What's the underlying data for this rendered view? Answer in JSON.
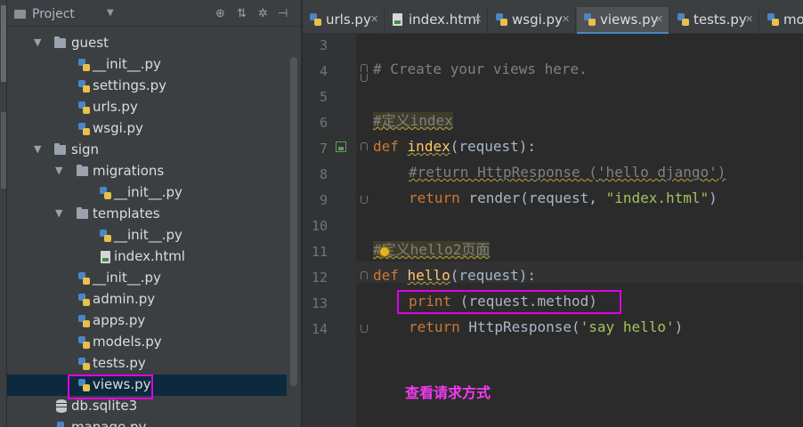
{
  "project_panel": {
    "title": "Project",
    "tree": [
      {
        "label": "guest",
        "kind": "folder"
      },
      {
        "label": "__init__.py",
        "kind": "py"
      },
      {
        "label": "settings.py",
        "kind": "py"
      },
      {
        "label": "urls.py",
        "kind": "py"
      },
      {
        "label": "wsgi.py",
        "kind": "py"
      },
      {
        "label": "sign",
        "kind": "folder"
      },
      {
        "label": "migrations",
        "kind": "folder"
      },
      {
        "label": "__init__.py",
        "kind": "py"
      },
      {
        "label": "templates",
        "kind": "folder"
      },
      {
        "label": "__init__.py",
        "kind": "py"
      },
      {
        "label": "index.html",
        "kind": "html"
      },
      {
        "label": "__init__.py",
        "kind": "py"
      },
      {
        "label": "admin.py",
        "kind": "py"
      },
      {
        "label": "apps.py",
        "kind": "py"
      },
      {
        "label": "models.py",
        "kind": "py"
      },
      {
        "label": "tests.py",
        "kind": "py"
      },
      {
        "label": "views.py",
        "kind": "py",
        "selected": true
      },
      {
        "label": "db.sqlite3",
        "kind": "db"
      },
      {
        "label": "manage.py",
        "kind": "py"
      }
    ]
  },
  "tabs": [
    {
      "label": "urls.py",
      "icon": "python-file-icon"
    },
    {
      "label": "index.html",
      "icon": "html-file-icon"
    },
    {
      "label": "wsgi.py",
      "icon": "python-file-icon"
    },
    {
      "label": "views.py",
      "icon": "python-file-icon",
      "active": true
    },
    {
      "label": "tests.py",
      "icon": "python-file-icon"
    },
    {
      "label": "mo",
      "icon": "python-file-icon"
    }
  ],
  "editor": {
    "line_numbers": [
      "3",
      "4",
      "5",
      "6",
      "7",
      "8",
      "9",
      "10",
      "11",
      "12",
      "13",
      "14"
    ],
    "code": {
      "l4": "# Create your views here.",
      "l6": "#定义index",
      "l7_kw": "def",
      "l7_fn": "index",
      "l7_rest": "(request):",
      "l8": "#return HttpResponse ('hello django')",
      "l9_kw": "return",
      "l9_mid": " render(request, ",
      "l9_str": "\"index.html\"",
      "l9_end": ")",
      "l11": "#定义hello2页面",
      "l12_kw": "def",
      "l12_fn": "hello",
      "l12_rest": "(request):",
      "l13_kw": "print",
      "l13_rest": " (request.method)",
      "l14_kw": "return",
      "l14_mid": " HttpResponse(",
      "l14_str": "'say hello'",
      "l14_end": ")"
    }
  },
  "annotation": "查看请求方式",
  "colors": {
    "highlight_box": "#e000e0",
    "annotation_text": "#f23bf2",
    "keyword": "#cc7832",
    "function": "#ffc66d",
    "string": "#a5c25c",
    "comment": "#808080"
  }
}
